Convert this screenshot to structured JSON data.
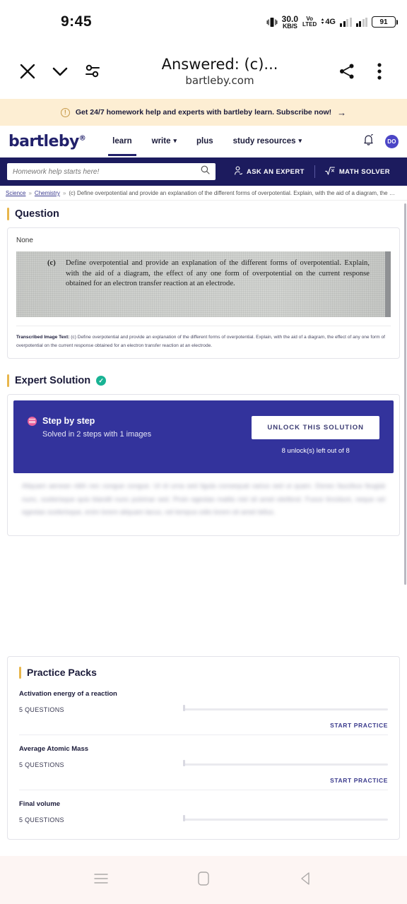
{
  "status_bar": {
    "time": "9:45",
    "net_speed_value": "30.0",
    "net_speed_unit": "KB/S",
    "volte_line1": "Vo",
    "volte_line2": "LTED",
    "network": "4G",
    "battery": "91"
  },
  "browser_toolbar": {
    "close_label": "close-tab",
    "collapse_label": "collapse",
    "tune_label": "page-options",
    "title": "Answered: (c)...",
    "domain": "bartleby.com",
    "share_label": "share",
    "more_label": "more-options"
  },
  "promo": {
    "text": "Get 24/7 homework help and experts with bartleby learn. Subscribe now!",
    "arrow": "→"
  },
  "nav": {
    "logo": "bartleby",
    "logo_mark": "®",
    "links": [
      {
        "label": "learn",
        "has_caret": false,
        "active": true
      },
      {
        "label": "write",
        "has_caret": true,
        "active": false
      },
      {
        "label": "plus",
        "has_caret": false,
        "active": false
      },
      {
        "label": "study resources",
        "has_caret": true,
        "active": false
      }
    ],
    "avatar_initials": "DO"
  },
  "search": {
    "placeholder": "Homework help starts here!",
    "value": "",
    "ask_expert": "ASK AN EXPERT",
    "math_solver": "MATH SOLVER"
  },
  "breadcrumb": {
    "items": [
      "Science",
      "Chemistry"
    ],
    "current": "(c) Define overpotential and provide an explanation of the different forms of overpotential. Explain, with the aid of a diagram, the …",
    "separator": "»"
  },
  "question": {
    "heading": "Question",
    "none_label": "None",
    "image_label": "(c)",
    "image_text": "Define overpotential and provide an explanation of the different forms of overpotential. Explain, with the aid of a diagram, the effect of any one form of overpotential on the current response obtained for an electron transfer reaction at an electrode.",
    "transcribed_label": "Transcribed Image Text:",
    "transcribed_text": "(c) Define overpotential and provide an explanation of the different forms of overpotential. Explain, with the aid of a diagram, the effect of any one form of overpotential on the current response obtained for an electron transfer reaction at an electrode."
  },
  "expert_solution": {
    "heading": "Expert Solution",
    "verified_mark": "✓",
    "step_by_step": "Step by step",
    "solved_in": "Solved in 2 steps with 1 images",
    "unlock_button": "UNLOCK THIS SOLUTION",
    "unlocks_left": "8 unlock(s) left out of 8",
    "blurred_body": "Aliquam aenean nibh nec congue congue. Ut id urna sed ligula consequat varius sed ut quam. Donec faucibus feugiat nunc, scelerisque quis blandit nunc pulvinar sed. Proin egestas mattis nisl sit amet eleifend. Fusce tincidunt, neque vel egestas scelerisque, enim lorem aliquam lacus, vel tempus odio lorem sit amet tellus."
  },
  "practice_packs": {
    "heading": "Practice Packs",
    "start_label": "START PRACTICE",
    "packs": [
      {
        "name": "Activation energy of a reaction",
        "questions": "5 QUESTIONS",
        "progress": 0
      },
      {
        "name": "Average Atomic Mass",
        "questions": "5 QUESTIONS",
        "progress": 0
      },
      {
        "name": "Final volume",
        "questions": "5 QUESTIONS",
        "progress": 0
      }
    ]
  },
  "android_nav": {
    "recents": "recent-apps",
    "home": "home",
    "back": "back"
  },
  "colors": {
    "brand_navy": "#1c1b5e",
    "solution_blue": "#33339c",
    "accent_gold": "#e8b64c",
    "verified_green": "#19b394",
    "promo_bg": "#fdeed3",
    "avatar": "#4b45c6",
    "pink": "#e8609b"
  }
}
